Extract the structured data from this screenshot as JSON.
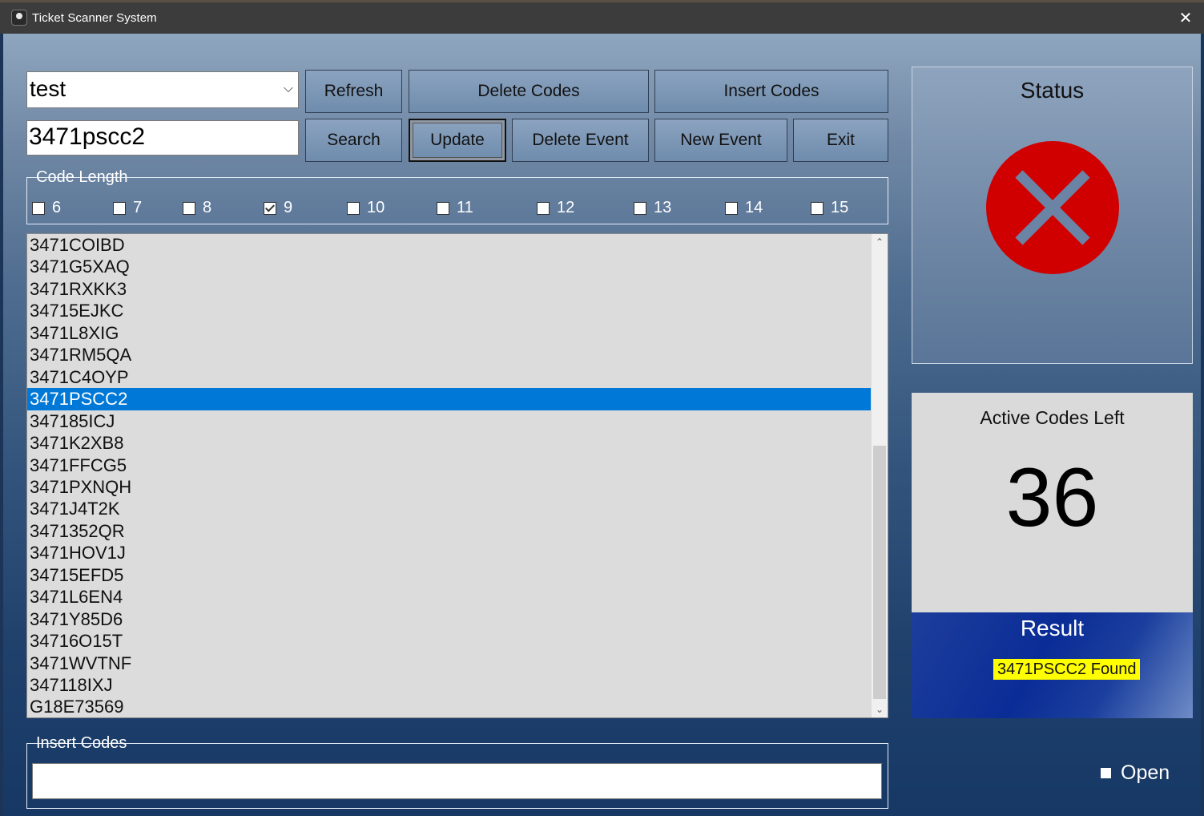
{
  "window": {
    "title": "Ticket Scanner System",
    "close_glyph": "✕"
  },
  "event_combo": {
    "value": "test",
    "chevron": "⌵"
  },
  "search_input": {
    "value": "3471pscc2"
  },
  "buttons": {
    "refresh": "Refresh",
    "delete_codes": "Delete Codes",
    "insert_codes": "Insert Codes",
    "search": "Search",
    "update": "Update",
    "delete_event": "Delete Event",
    "new_event": "New Event",
    "exit": "Exit"
  },
  "code_length": {
    "title": "Code Length",
    "options": [
      {
        "label": "6",
        "checked": false
      },
      {
        "label": "7",
        "checked": false
      },
      {
        "label": "8",
        "checked": false
      },
      {
        "label": "9",
        "checked": true
      },
      {
        "label": "10",
        "checked": false
      },
      {
        "label": "11",
        "checked": false
      },
      {
        "label": "12",
        "checked": false
      },
      {
        "label": "13",
        "checked": false
      },
      {
        "label": "14",
        "checked": false
      },
      {
        "label": "15",
        "checked": false
      }
    ]
  },
  "codes_list": {
    "items": [
      "3471COIBD",
      "3471G5XAQ",
      "3471RXKK3",
      "34715EJKC",
      "3471L8XIG",
      "3471RM5QA",
      "3471C4OYP",
      "3471PSCC2",
      "347185ICJ",
      "3471K2XB8",
      "3471FFCG5",
      "3471PXNQH",
      "3471J4T2K",
      "3471352QR",
      "3471HOV1J",
      "34715EFD5",
      "3471L6EN4",
      "3471Y85D6",
      "34716O15T",
      "3471WVTNF",
      "347118IXJ",
      "G18E73569"
    ],
    "selected_index": 7,
    "scroll_up": "⌃",
    "scroll_down": "⌄"
  },
  "insert_codes_group": {
    "title": "Insert Codes",
    "value": ""
  },
  "status_panel": {
    "title": "Status",
    "icon": "error-x-icon",
    "icon_color": "#d00000"
  },
  "active_codes": {
    "title": "Active Codes Left",
    "count": "36"
  },
  "result_panel": {
    "title": "Result",
    "message": "3471PSCC2 Found"
  },
  "open_checkbox": {
    "label": "Open",
    "checked": false
  }
}
